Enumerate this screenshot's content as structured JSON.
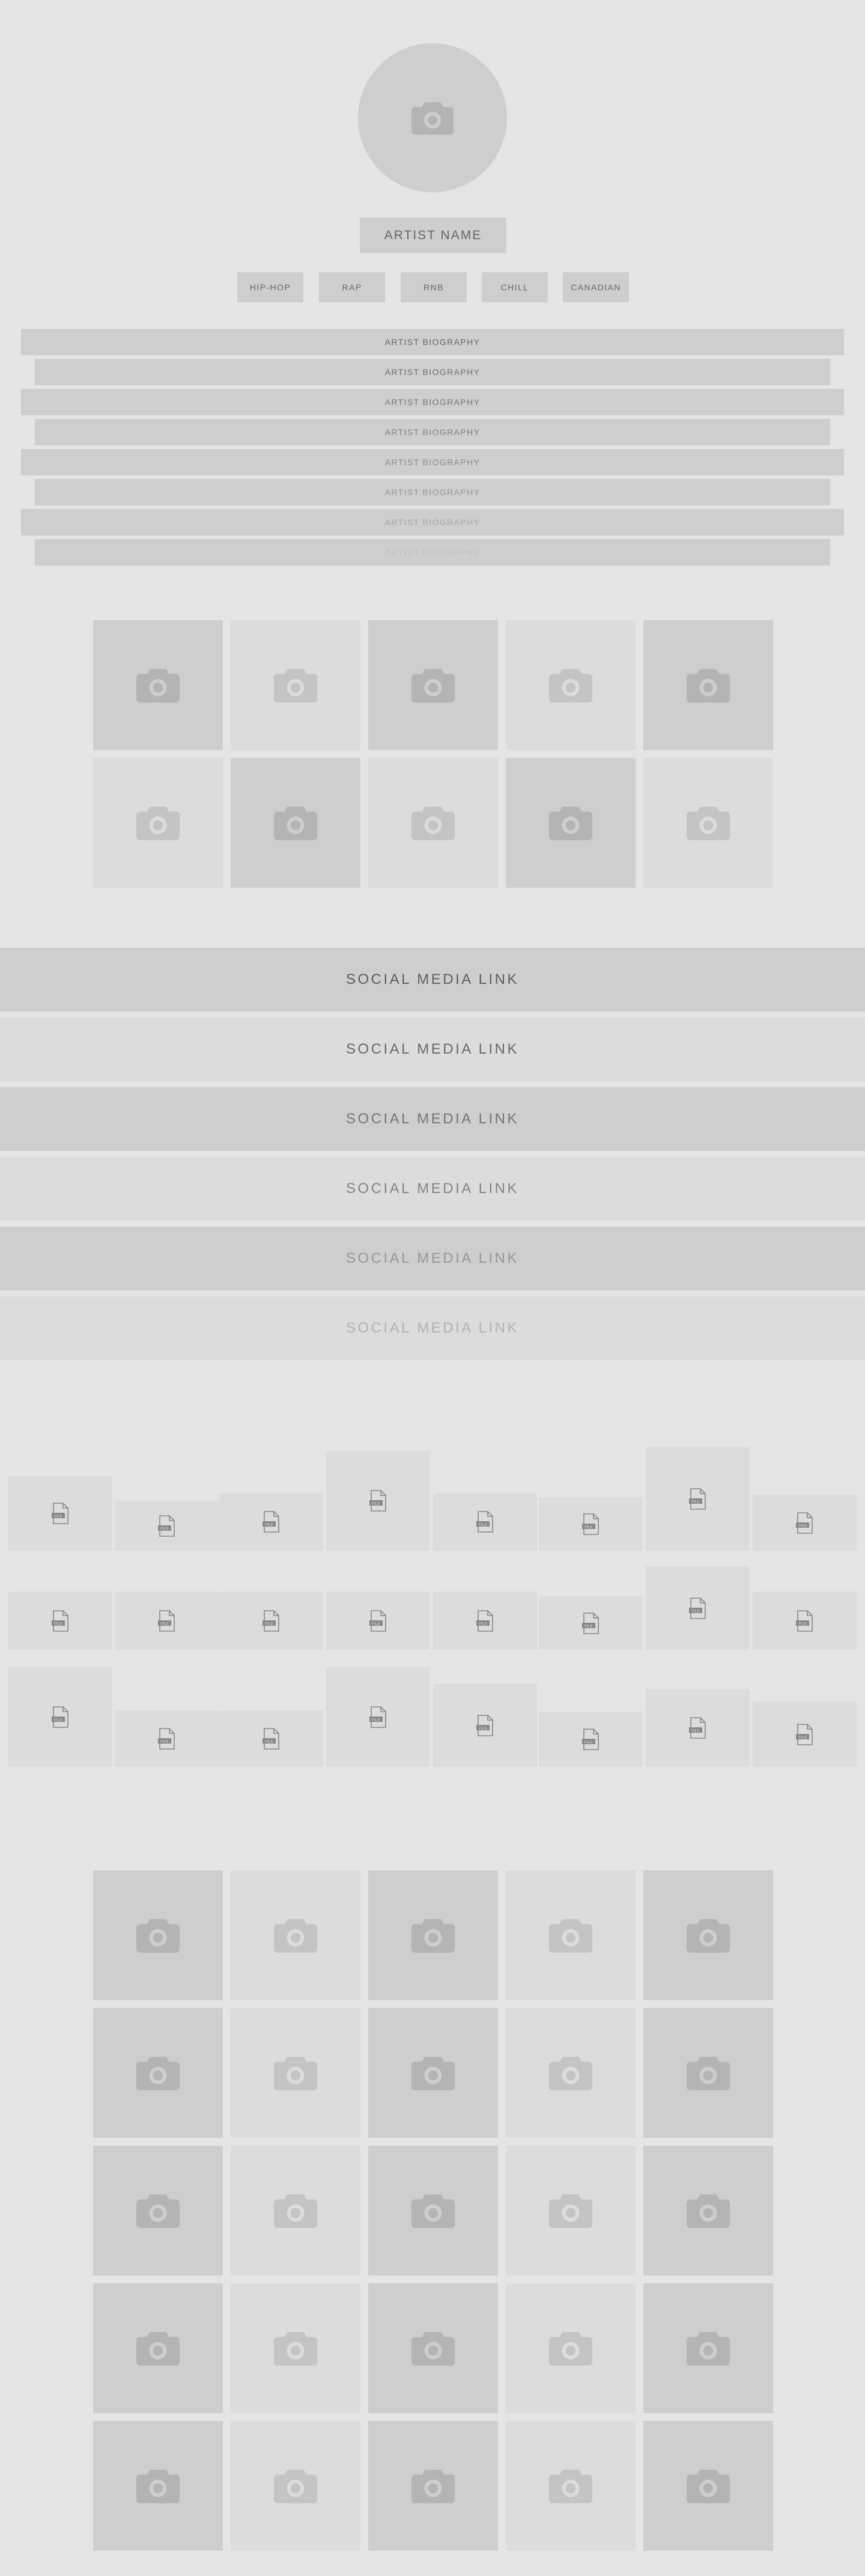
{
  "profile": {
    "artist_name": "ARTIST  NAME",
    "avatar_icon": "camera-icon",
    "genres": [
      "HIP-HOP",
      "RAP",
      "RNB",
      "CHILL",
      "CANADIAN"
    ]
  },
  "biography": {
    "lines": [
      "ARTIST BIOGRAPHY",
      "ARTIST BIOGRAPHY",
      "ARTIST BIOGRAPHY",
      "ARTIST BIOGRAPHY",
      "ARTIST BIOGRAPHY",
      "ARTIST BIOGRAPHY",
      "ARTIST BIOGRAPHY",
      "ARTIST BIOGRAPHY"
    ]
  },
  "gallery_top": {
    "icon": "camera-icon",
    "count": 10
  },
  "social_links": {
    "labels": [
      "SOCIAL MEDIA LINK",
      "SOCIAL MEDIA LINK",
      "SOCIAL MEDIA LINK",
      "SOCIAL MEDIA LINK",
      "SOCIAL MEDIA LINK",
      "SOCIAL MEDIA LINK"
    ]
  },
  "files": {
    "icon": "file-icon",
    "badge": "FILE",
    "count": 24
  },
  "gallery_bottom": {
    "icon": "camera-icon",
    "count": 25
  },
  "colors": {
    "background": "#e5e5e5",
    "placeholder_dark": "#cecece",
    "placeholder_light": "#dcdcdc",
    "icon": "#aaaaaa",
    "text": "#666666"
  }
}
